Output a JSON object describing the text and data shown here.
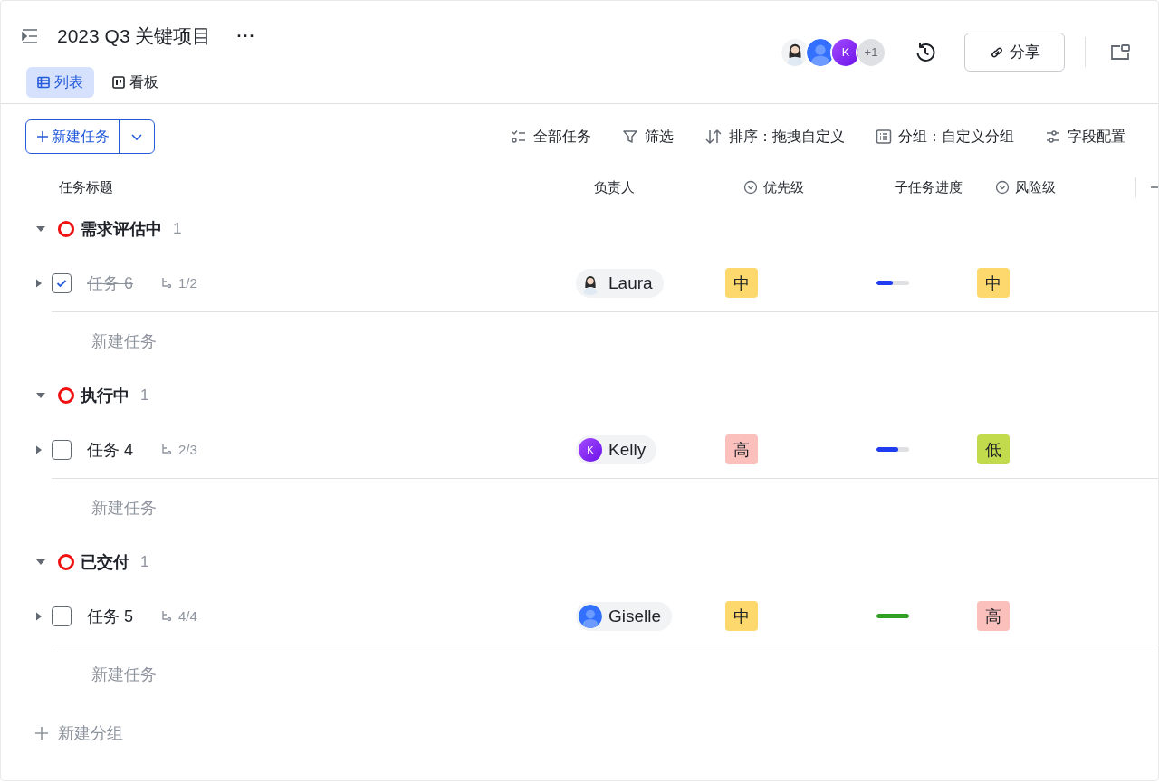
{
  "header": {
    "title": "2023 Q3 关键项目",
    "more": "···",
    "views": [
      {
        "label": "列表",
        "kind": "list",
        "selected": true
      },
      {
        "label": "看板",
        "kind": "board",
        "selected": false
      }
    ],
    "collaborators": [
      {
        "kind": "photo"
      },
      {
        "kind": "silhouette"
      },
      {
        "kind": "letter",
        "letter": "K"
      }
    ],
    "collaborators_more": "+1",
    "share": "分享"
  },
  "toolbar": {
    "new_task": "新建任务",
    "actions": [
      {
        "label": "全部任务",
        "kind": "tasks"
      },
      {
        "label": "筛选",
        "kind": "filter"
      },
      {
        "label": "排序：拖拽自定义",
        "kind": "sort"
      },
      {
        "label": "分组：自定义分组",
        "kind": "group"
      },
      {
        "label": "字段配置",
        "kind": "fields"
      }
    ]
  },
  "table": {
    "columns": [
      {
        "label": "任务标题",
        "kind": "text"
      },
      {
        "label": "负责人",
        "kind": "text"
      },
      {
        "label": "优先级",
        "kind": "option"
      },
      {
        "label": "子任务进度",
        "kind": "text"
      },
      {
        "label": "风险级",
        "kind": "option"
      }
    ],
    "groups": [
      {
        "name": "需求评估中",
        "count": "1",
        "expanded": true,
        "tasks": [
          {
            "title": "任务 6",
            "checked": true,
            "subtasks": "1/2",
            "assignee": {
              "name": "Laura",
              "kind": "photo"
            },
            "priority": {
              "label": "中",
              "color": "#fcd86d"
            },
            "level": 0.5,
            "risk": {
              "label": "中",
              "color": "#fcd86d"
            }
          }
        ],
        "new_task": "新建任务"
      },
      {
        "name": "执行中",
        "count": "1",
        "expanded": true,
        "tasks": [
          {
            "title": "任务 4",
            "checked": false,
            "subtasks": "2/3",
            "assignee": {
              "name": "Kelly",
              "kind": "letter",
              "letter": "K"
            },
            "priority": {
              "label": "高",
              "color": "#fbbfbc"
            },
            "level": 0.67,
            "risk": {
              "label": "低",
              "color": "#c1db4d"
            }
          }
        ],
        "new_task": "新建任务"
      },
      {
        "name": "已交付",
        "count": "1",
        "expanded": true,
        "tasks": [
          {
            "title": "任务 5",
            "checked": false,
            "subtasks": "4/4",
            "assignee": {
              "name": "Giselle",
              "kind": "silhouette"
            },
            "priority": {
              "label": "中",
              "color": "#fcd86d"
            },
            "level": 1,
            "risk": {
              "label": "高",
              "color": "#fbbfbc"
            }
          }
        ],
        "new_task": "新建任务"
      }
    ],
    "new_group": "新建分组"
  }
}
